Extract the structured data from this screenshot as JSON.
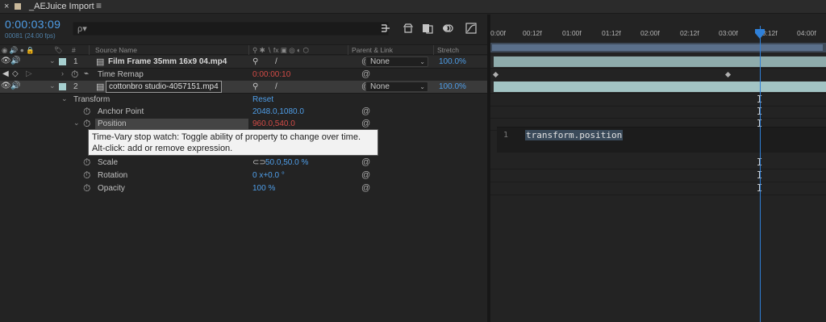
{
  "tab": {
    "close": "×",
    "title": "_AEJuice Import",
    "menu": "≡"
  },
  "timeline": {
    "timecode": "0:00:03:09",
    "frames": "00081 (24.00 fps)",
    "search_glyph": "ρ▾"
  },
  "columns": {
    "number": "#",
    "source_name": "Source Name",
    "parent_link": "Parent & Link",
    "stretch": "Stretch"
  },
  "layers": [
    {
      "number": "1",
      "name": "Film Frame 35mm 16x9 04.mp4",
      "parent": "None",
      "stretch": "100.0%",
      "swatch": "#a6cfcf"
    },
    {
      "number": "2",
      "name": "cottonbro studio-4057151.mp4",
      "parent": "None",
      "stretch": "100.0%",
      "swatch": "#a6cfcf"
    }
  ],
  "time_remap": {
    "label": "Time Remap",
    "value": "0:00:00:10"
  },
  "transform": {
    "label": "Transform",
    "reset": "Reset",
    "anchor_point": {
      "label": "Anchor Point",
      "value": "2048.0,1080.0"
    },
    "position": {
      "label": "Position",
      "value": "960.0,540.0"
    },
    "scale": {
      "label": "Scale",
      "value": "50.0,50.0 %"
    },
    "rotation": {
      "label": "Rotation",
      "value": "0 x+0.0 °"
    },
    "opacity": {
      "label": "Opacity",
      "value": "100 %"
    }
  },
  "tooltip": {
    "text": "Time-Vary stop watch: Toggle ability of property to change over time. Alt-click: add or remove expression."
  },
  "ruler": {
    "ticks": [
      "0:00f",
      "00:12f",
      "01:00f",
      "01:12f",
      "02:00f",
      "02:12f",
      "03:00f",
      "03:12f",
      "04:00f"
    ]
  },
  "expression": {
    "line_number": "1",
    "code": "transform.position"
  },
  "colors": {
    "accent_blue": "#4f9ee8",
    "keyframe_red": "#d24b46",
    "layer_bar": "#8eabab",
    "playhead": "#2f80d8"
  }
}
